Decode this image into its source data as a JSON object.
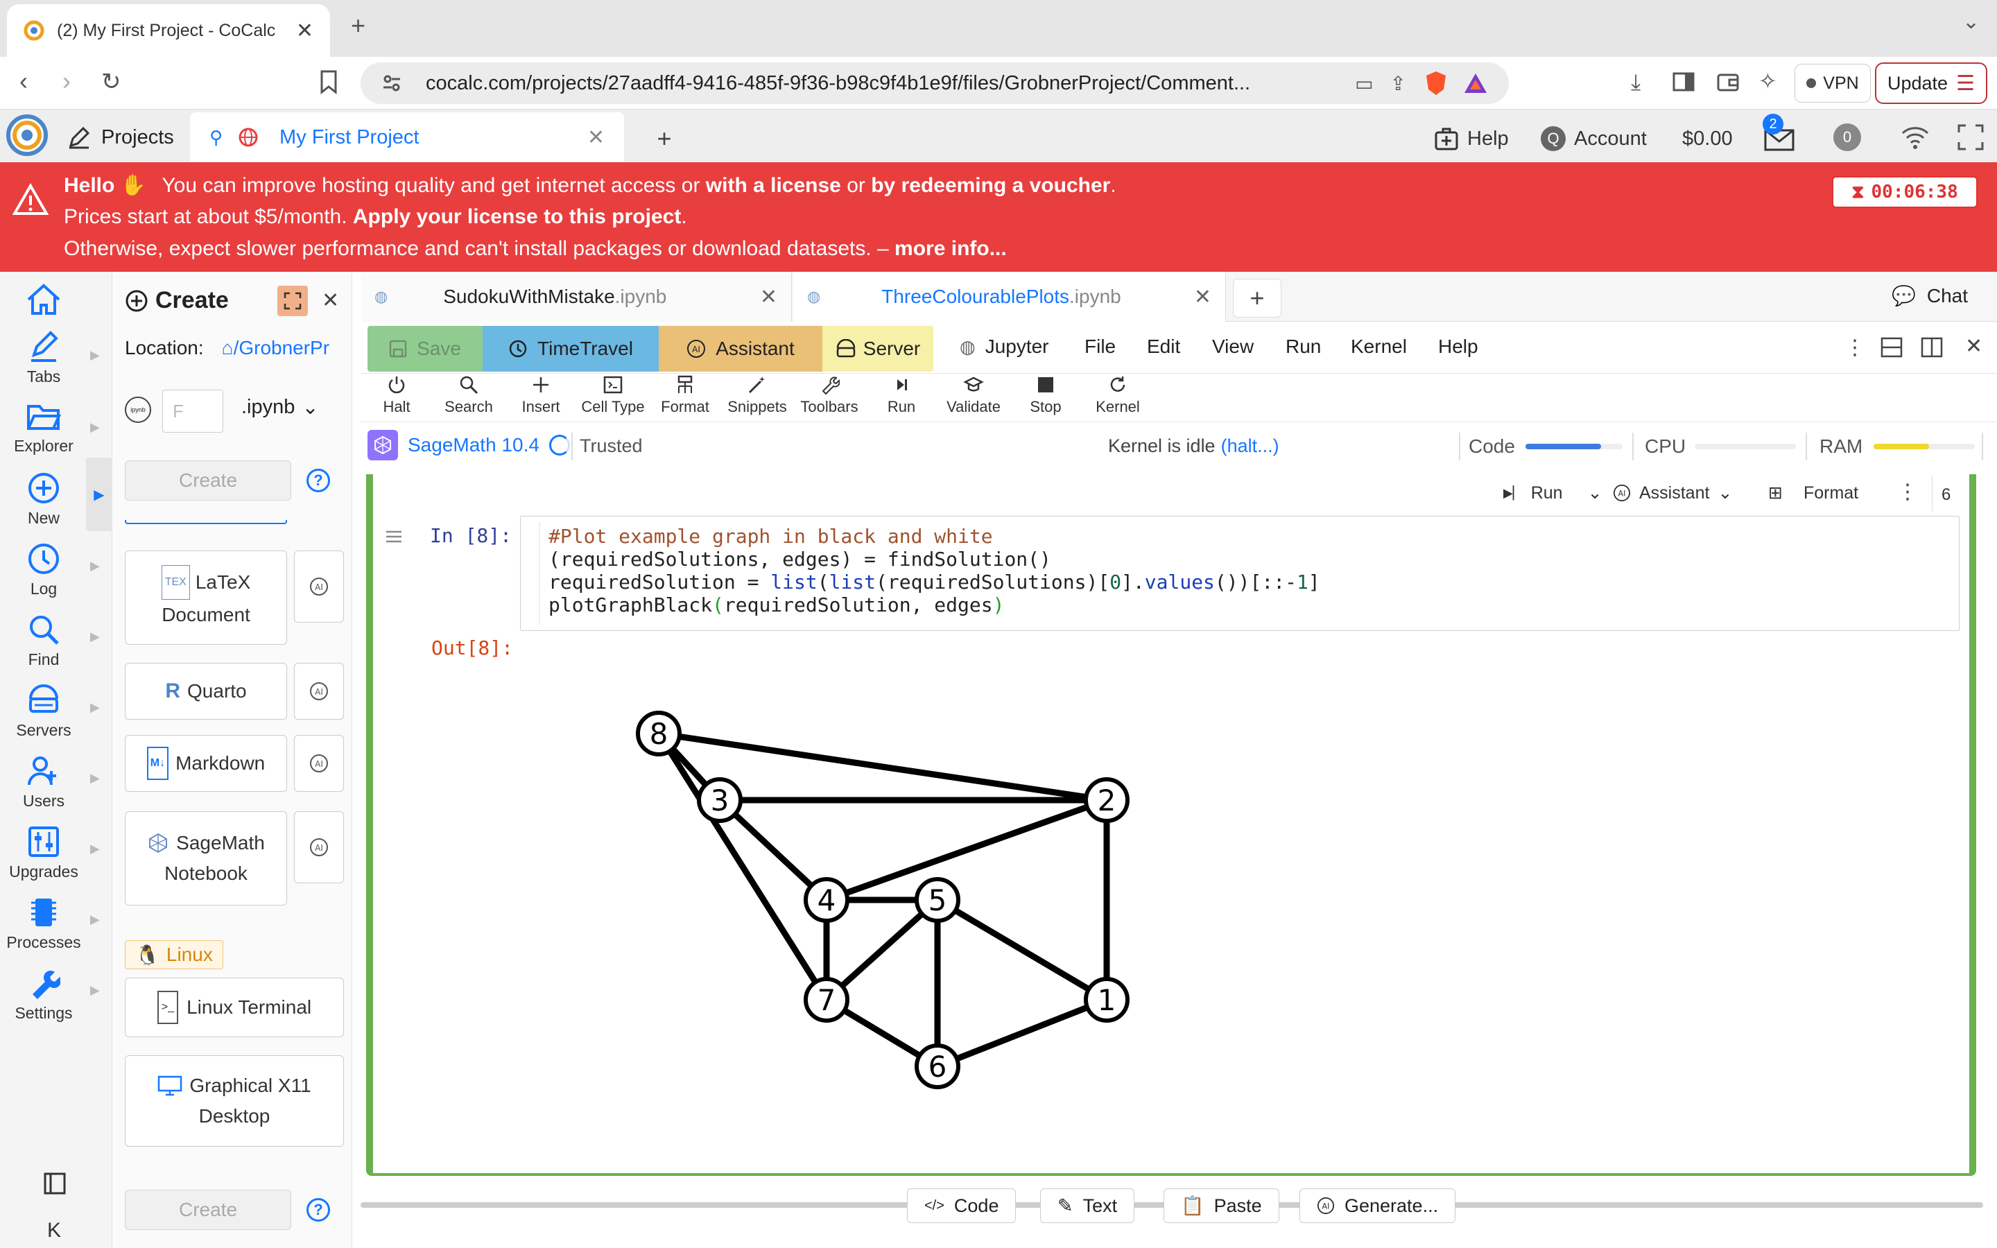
{
  "browser": {
    "tab_title": "(2) My First Project - CoCalc",
    "url": "cocalc.com/projects/27aadff4-9416-485f-9f36-b98c9f4b1e9f/files/GrobnerProject/Comment...",
    "vpn_label": "VPN",
    "update_label": "Update"
  },
  "cocalc_topbar": {
    "projects_label": "Projects",
    "project_tab_label": "My First Project",
    "help_label": "Help",
    "account_label": "Account",
    "balance": "$0.00",
    "notification_count": "2",
    "news_count": "0"
  },
  "banner": {
    "hello": "Hello",
    "line1_a": "You can improve hosting quality and get internet access or",
    "line1_b": "with a license",
    "line1_c": "or",
    "line1_d": "by redeeming a voucher",
    "line1_e": ".",
    "line2_a": "Prices start at about $5/month.",
    "line2_b": "Apply your license to this project",
    "line2_c": ".",
    "line3_a": "Otherwise, expect slower performance and can't install packages or download datasets. –",
    "line3_b": "more info...",
    "timer": "00:06:38"
  },
  "rail": {
    "items": [
      "Tabs",
      "Explorer",
      "New",
      "Log",
      "Find",
      "Servers",
      "Users",
      "Upgrades",
      "Processes",
      "Settings"
    ]
  },
  "create_panel": {
    "title": "Create",
    "location_label": "Location:",
    "location_path": "/GrobnerPr",
    "filename_placeholder": "F",
    "ext": ".ipynb",
    "create_label": "Create",
    "cards": {
      "latex_1": "LaTeX",
      "latex_2": "Document",
      "quarto": "Quarto",
      "markdown": "Markdown",
      "sage_1": "SageMath",
      "sage_2": "Notebook",
      "linux_tag": "Linux",
      "terminal": "Linux Terminal",
      "x11_1": "Graphical X11",
      "x11_2": "Desktop"
    }
  },
  "file_tabs": {
    "tab1_name": "SudokuWithMistake",
    "tab1_ext": ".ipynb",
    "tab2_name": "ThreeColourablePlots",
    "tab2_ext": ".ipynb",
    "chat_label": "Chat"
  },
  "toolbar": {
    "save": "Save",
    "timetravel": "TimeTravel",
    "assistant": "Assistant",
    "server": "Server",
    "menus": [
      "Jupyter",
      "File",
      "Edit",
      "View",
      "Run",
      "Kernel",
      "Help"
    ],
    "buttons": [
      "Halt",
      "Search",
      "Insert",
      "Cell Type",
      "Format",
      "Snippets",
      "Toolbars",
      "Run",
      "Validate",
      "Stop",
      "Kernel"
    ]
  },
  "status": {
    "kernel_name": "SageMath 10.4",
    "trusted": "Trusted",
    "kernel_state": "Kernel is idle",
    "halt_link": "(halt...)",
    "code_label": "Code",
    "cpu_label": "CPU",
    "ram_label": "RAM",
    "code_level": 0.78,
    "cpu_level": 0.0,
    "ram_level": 0.55,
    "colors": {
      "code": "#3f7be0",
      "ram": "#f0d830"
    }
  },
  "cell": {
    "run_label": "Run",
    "assistant_label": "Assistant",
    "format_label": "Format",
    "count": "6",
    "in_prompt": "In [8]:",
    "out_prompt": "Out[8]:",
    "code": {
      "l1": "#Plot example graph in black and white",
      "l2": "(requiredSolutions, edges) = findSolution()",
      "l3_a": "requiredSolution = ",
      "l3_b": "list",
      "l3_c": "(",
      "l3_d": "list",
      "l3_e": "(requiredSolutions)[",
      "l3_f": "0",
      "l3_g": "].",
      "l3_h": "values",
      "l3_i": "())[::-",
      "l3_j": "1",
      "l3_k": "]",
      "l4_a": "plotGraphBlack",
      "l4_b": "(",
      "l4_c": "requiredSolution, edges",
      "l4_d": ")"
    }
  },
  "graph": {
    "nodes": [
      {
        "id": "8"
      },
      {
        "id": "3"
      },
      {
        "id": "2"
      },
      {
        "id": "4"
      },
      {
        "id": "5"
      },
      {
        "id": "7"
      },
      {
        "id": "1"
      },
      {
        "id": "6"
      }
    ],
    "edges": [
      [
        "8",
        "3"
      ],
      [
        "8",
        "2"
      ],
      [
        "8",
        "7"
      ],
      [
        "3",
        "2"
      ],
      [
        "3",
        "4"
      ],
      [
        "2",
        "4"
      ],
      [
        "2",
        "1"
      ],
      [
        "4",
        "5"
      ],
      [
        "4",
        "7"
      ],
      [
        "5",
        "7"
      ],
      [
        "5",
        "6"
      ],
      [
        "5",
        "1"
      ],
      [
        "7",
        "6"
      ],
      [
        "6",
        "1"
      ]
    ]
  },
  "insert_bar": {
    "code": "Code",
    "text": "Text",
    "paste": "Paste",
    "generate": "Generate..."
  }
}
